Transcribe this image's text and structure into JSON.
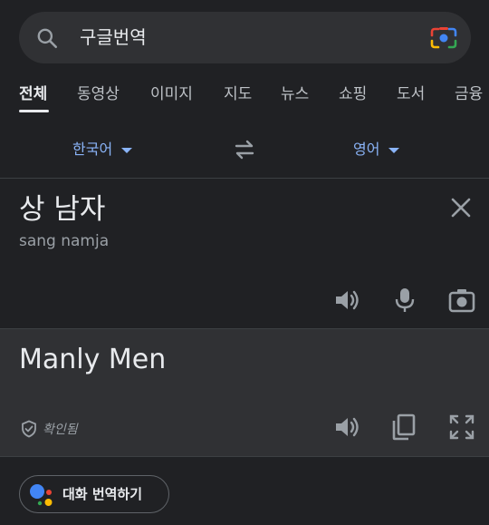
{
  "search": {
    "query": "구글번역",
    "icons": {
      "search": "search-icon",
      "lens": "google-lens-icon"
    }
  },
  "tabs": [
    {
      "label": "전체",
      "active": true
    },
    {
      "label": "동영상",
      "active": false
    },
    {
      "label": "이미지",
      "active": false
    },
    {
      "label": "지도",
      "active": false
    },
    {
      "label": "뉴스",
      "active": false
    },
    {
      "label": "쇼핑",
      "active": false
    },
    {
      "label": "도서",
      "active": false
    },
    {
      "label": "금융",
      "active": false
    }
  ],
  "translator": {
    "source_lang": "한국어",
    "target_lang": "영어",
    "source_text": "상 남자",
    "romanization": "sang namja",
    "translated_text": "Manly Men",
    "verified_label": "확인됨",
    "conversation_button": "대화 번역하기"
  },
  "colors": {
    "background": "#202124",
    "panel": "#303134",
    "accent_blue": "#8ab4f8",
    "text_primary": "#e8eaed",
    "text_secondary": "#9aa0a6"
  }
}
